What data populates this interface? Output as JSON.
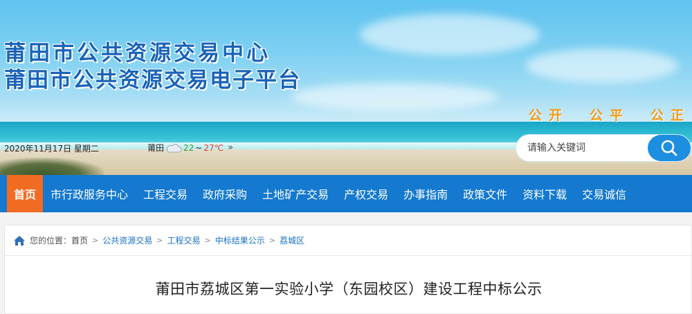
{
  "header": {
    "title_line1": "莆田市公共资源交易中心",
    "title_line2": "莆田市公共资源交易电子平台",
    "slogans": [
      "公开",
      "公平",
      "公正"
    ],
    "date": "2020年11月17日 星期二",
    "weather": {
      "city": "莆田",
      "icon": "cloudy-icon",
      "temp_low": "22",
      "temp_sep": "~",
      "temp_high": "27℃",
      "more": "»"
    },
    "search": {
      "placeholder": "请输入关键词",
      "icon": "search-icon"
    }
  },
  "nav": {
    "items": [
      {
        "label": "首页",
        "active": true
      },
      {
        "label": "市行政服务中心"
      },
      {
        "label": "工程交易"
      },
      {
        "label": "政府采购"
      },
      {
        "label": "土地矿产交易"
      },
      {
        "label": "产权交易"
      },
      {
        "label": "办事指南"
      },
      {
        "label": "政策文件"
      },
      {
        "label": "资料下载"
      },
      {
        "label": "交易诚信"
      }
    ]
  },
  "breadcrumb": {
    "icon": "home-icon",
    "prefix": "您的位置：",
    "items": [
      "首页",
      "公共资源交易",
      "工程交易",
      "中标结果公示",
      "荔城区"
    ],
    "separator": ">"
  },
  "article": {
    "title": "莆田市荔城区第一实验小学（东园校区）建设工程中标公示"
  },
  "colors": {
    "nav_bg": "#1479cf",
    "nav_active": "#f26b22",
    "title_blue": "#1a63b8",
    "slogan_orange": "#f39a14",
    "search_button": "#1e8ee0"
  }
}
